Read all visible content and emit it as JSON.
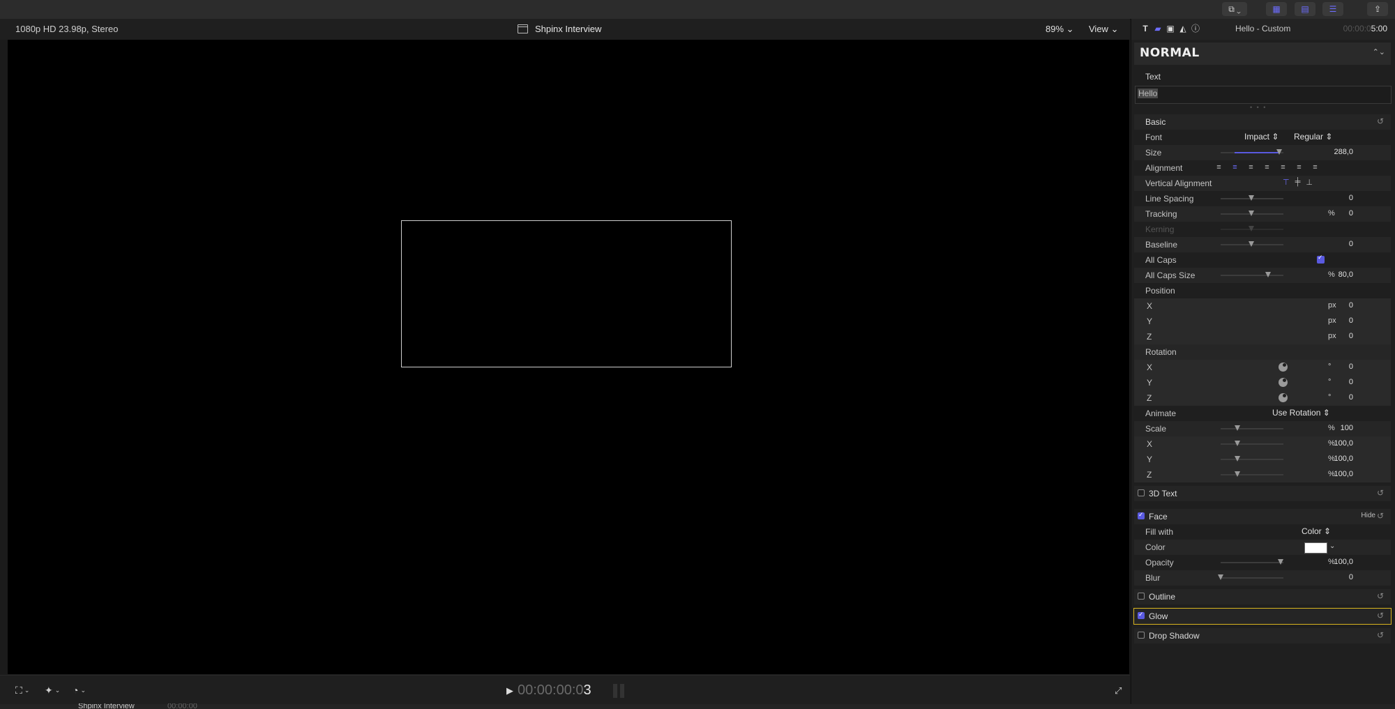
{
  "viewer": {
    "format": "1080p HD 23.98p, Stereo",
    "project": "Shpinx Interview",
    "zoom": "89%",
    "view": "View",
    "timecode_dim": "00:00:00:0",
    "timecode_last": "3",
    "bottom_project": "Shpinx Interview",
    "bottom_tc": "00:00:00"
  },
  "inspector": {
    "title": "Hello - Custom",
    "time_dim": "00:00:0",
    "time": "5:00",
    "preset": "Normal",
    "text_label": "Text",
    "text_value": "Hello",
    "basic": "Basic",
    "rows": {
      "font": {
        "label": "Font",
        "family": "Impact",
        "style": "Regular"
      },
      "size": {
        "label": "Size",
        "value": "288,0"
      },
      "alignment": {
        "label": "Alignment"
      },
      "valign": {
        "label": "Vertical Alignment"
      },
      "line_spacing": {
        "label": "Line Spacing",
        "value": "0"
      },
      "tracking": {
        "label": "Tracking",
        "value": "0",
        "unit": "%"
      },
      "kerning": {
        "label": "Kerning"
      },
      "baseline": {
        "label": "Baseline",
        "value": "0"
      },
      "all_caps": {
        "label": "All Caps"
      },
      "all_caps_size": {
        "label": "All Caps Size",
        "value": "80,0",
        "unit": "%"
      },
      "position": {
        "label": "Position"
      },
      "pos_x": {
        "label": "X",
        "value": "0",
        "unit": "px"
      },
      "pos_y": {
        "label": "Y",
        "value": "0",
        "unit": "px"
      },
      "pos_z": {
        "label": "Z",
        "value": "0",
        "unit": "px"
      },
      "rotation": {
        "label": "Rotation"
      },
      "rot_x": {
        "label": "X",
        "value": "0",
        "unit": "°"
      },
      "rot_y": {
        "label": "Y",
        "value": "0",
        "unit": "°"
      },
      "rot_z": {
        "label": "Z",
        "value": "0",
        "unit": "°"
      },
      "animate": {
        "label": "Animate",
        "value": "Use Rotation"
      },
      "scale": {
        "label": "Scale",
        "value": "100",
        "unit": "%"
      },
      "scale_x": {
        "label": "X",
        "value": "100,0",
        "unit": "%"
      },
      "scale_y": {
        "label": "Y",
        "value": "100,0",
        "unit": "%"
      },
      "scale_z": {
        "label": "Z",
        "value": "100,0",
        "unit": "%"
      },
      "fill_with": {
        "label": "Fill with",
        "value": "Color"
      },
      "color": {
        "label": "Color"
      },
      "opacity": {
        "label": "Opacity",
        "value": "100,0",
        "unit": "%"
      },
      "blur": {
        "label": "Blur",
        "value": "0"
      }
    },
    "sections": {
      "text3d": "3D Text",
      "face": "Face",
      "face_hide": "Hide",
      "outline": "Outline",
      "glow": "Glow",
      "drop_shadow": "Drop Shadow"
    }
  },
  "colors": {
    "accent": "#5a5ae0",
    "highlight": "#d9b51f"
  }
}
